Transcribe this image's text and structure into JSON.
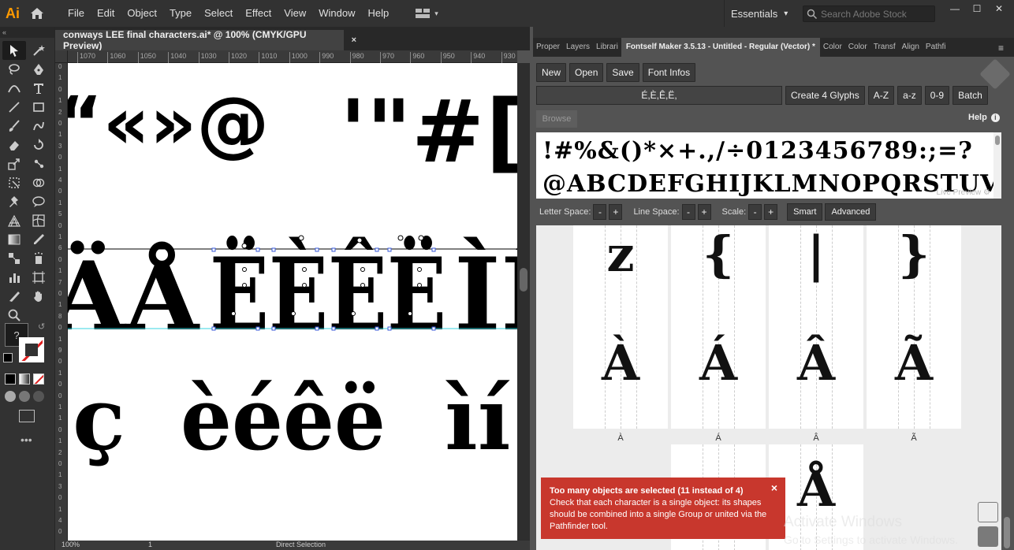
{
  "app": {
    "logo": "Ai",
    "menu": [
      "File",
      "Edit",
      "Object",
      "Type",
      "Select",
      "Effect",
      "View",
      "Window",
      "Help"
    ]
  },
  "workspace": {
    "label": "Essentials",
    "search_placeholder": "Search Adobe Stock"
  },
  "document": {
    "tab_title": "conways LEE final characters.ai* @ 100% (CMYK/GPU Preview)",
    "close": "×"
  },
  "ruler": {
    "h_ticks": [
      "1070",
      "1060",
      "1050",
      "1040",
      "1030",
      "1020",
      "1010",
      "1000",
      "990",
      "980",
      "970",
      "960",
      "950",
      "940",
      "930"
    ],
    "v_ticks": [
      "0",
      "1",
      "0",
      "1",
      "2",
      "0",
      "1",
      "3",
      "0",
      "1",
      "4",
      "0",
      "1",
      "5",
      "0",
      "1",
      "6",
      "0",
      "1",
      "7",
      "0",
      "1",
      "8",
      "0",
      "1",
      "9",
      "0",
      "1",
      "0",
      "0",
      "1",
      "1",
      "0",
      "1",
      "2",
      "0",
      "1",
      "3",
      "0",
      "1",
      "4",
      "0"
    ]
  },
  "canvas": {
    "row1": "“«»@",
    "row1b": "'\"#",
    "row1c": "[",
    "row2": "ÄÅ",
    "row2b": "ËÈÊË",
    "row2c": "ÌÍ",
    "row3a": "ç",
    "row3b": "èéêë",
    "row3c": "ìí"
  },
  "status": {
    "zoom": "100%",
    "page": "1",
    "tool": "Direct Selection"
  },
  "panel": {
    "tabs": [
      "Proper",
      "Layers",
      "Librari",
      "Fontself Maker 3.5.13 - Untitled - Regular (Vector) *",
      "Color",
      "Color",
      "Transf",
      "Align",
      "Pathfi"
    ],
    "buttons_row1": [
      "New",
      "Open",
      "Save",
      "Font Infos"
    ],
    "glyph_input_value": "É,È,Ê,Ë,",
    "buttons_row2": [
      "Create 4 Glyphs",
      "A-Z",
      "a-z",
      "0-9",
      "Batch"
    ],
    "browse": "Browse",
    "help": "Help",
    "preview_line1": "!#%&()*×+.,/÷0123456789:;=?",
    "preview_line2": "@ABCDEFGHIJKLMNOPQRSTUV",
    "live_preview": "Live Preview",
    "letter_space": "Letter Space:",
    "line_space": "Line Space:",
    "scale": "Scale:",
    "minus": "-",
    "plus": "+",
    "smart": "Smart",
    "advanced": "Advanced"
  },
  "glyphs": [
    {
      "char": "z",
      "label": "z"
    },
    {
      "char": "{",
      "label": "{"
    },
    {
      "char": "|",
      "label": "|"
    },
    {
      "char": "}",
      "label": "}"
    },
    {
      "char": "À",
      "label": "À"
    },
    {
      "char": "Á",
      "label": "Á"
    },
    {
      "char": "Â",
      "label": "Â"
    },
    {
      "char": "Ã",
      "label": "Ã"
    },
    {
      "char": "",
      "label": ""
    },
    {
      "char": "Å",
      "label": ""
    }
  ],
  "error": {
    "title": "Too many objects are selected (11 instead of 4)",
    "body": "Check that each character is a single object: its shapes should be combined into a single Group or united via the Pathfinder tool.",
    "close": "×"
  },
  "watermark": {
    "title": "Activate Windows",
    "subtitle": "Go to Settings to activate Windows."
  },
  "colors": {
    "error_bg": "#c8372d",
    "ai_orange": "#ff9a00",
    "guide_cyan": "#3ad6e0"
  }
}
